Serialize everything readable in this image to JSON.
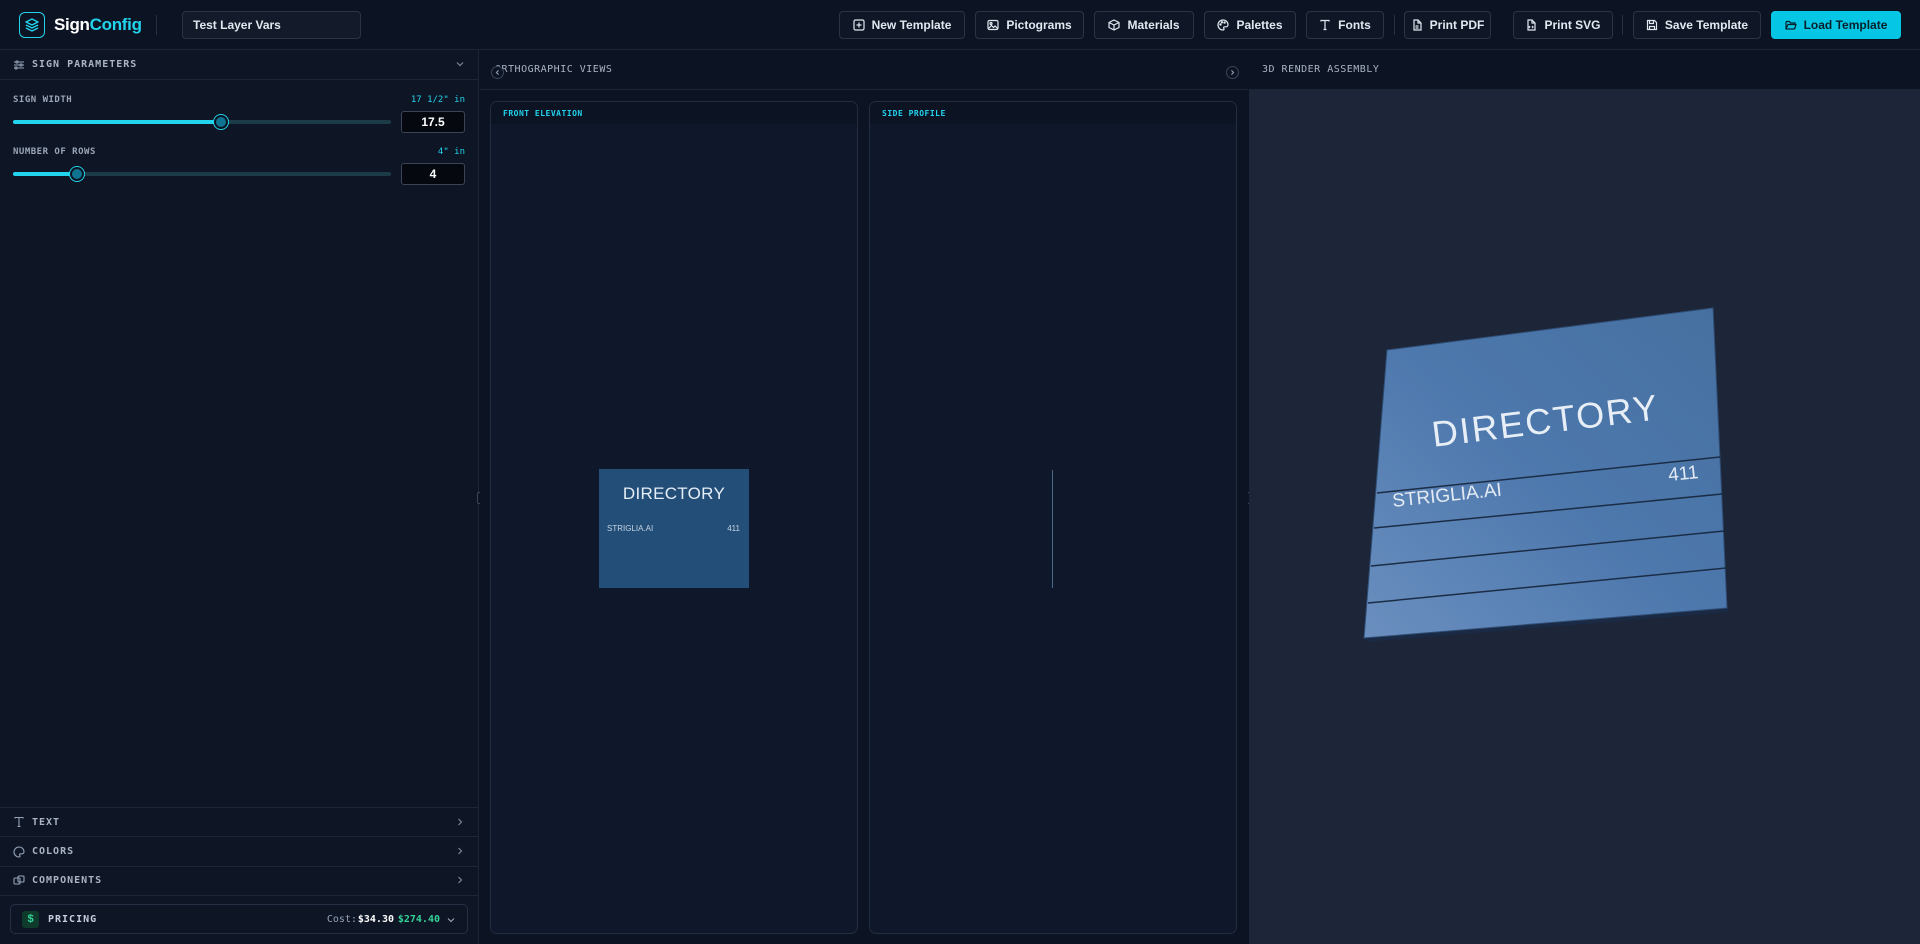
{
  "header": {
    "brand_part1": "Sign",
    "brand_part2": "Config",
    "template_name": "Test Layer Vars",
    "buttons": {
      "new_template": "New Template",
      "pictograms": "Pictograms",
      "materials": "Materials",
      "palettes": "Palettes",
      "fonts": "Fonts",
      "print_pdf": "Print PDF",
      "print_svg": "Print SVG",
      "save_template": "Save Template",
      "load_template": "Load Template"
    },
    "accent_color": "#06c6e6"
  },
  "left_panel": {
    "sign_parameters": {
      "title": "SIGN PARAMETERS",
      "width": {
        "label": "SIGN WIDTH",
        "hint": "17 1/2\" in",
        "value": "17.5",
        "slider_fraction": 0.55
      },
      "rows": {
        "label": "NUMBER OF ROWS",
        "hint": "4\" in",
        "value": "4",
        "slider_fraction": 0.17
      }
    },
    "sections": {
      "text": "TEXT",
      "colors": "COLORS",
      "components": "COMPONENTS"
    },
    "pricing": {
      "label": "PRICING",
      "cost_label": "Cost:",
      "cost": "$34.30",
      "price": "$274.40"
    }
  },
  "ortho": {
    "title": "ORTHOGRAPHIC VIEWS",
    "front": {
      "title": "FRONT ELEVATION",
      "sign_title": "DIRECTORY",
      "row_name": "STRIGLIA.AI",
      "row_number": "411"
    },
    "side": {
      "title": "SIDE PROFILE"
    }
  },
  "render": {
    "title": "3D RENDER ASSEMBLY",
    "sign_title": "DIRECTORY",
    "row_name": "STRIGLIA.AI",
    "row_number": "411"
  }
}
